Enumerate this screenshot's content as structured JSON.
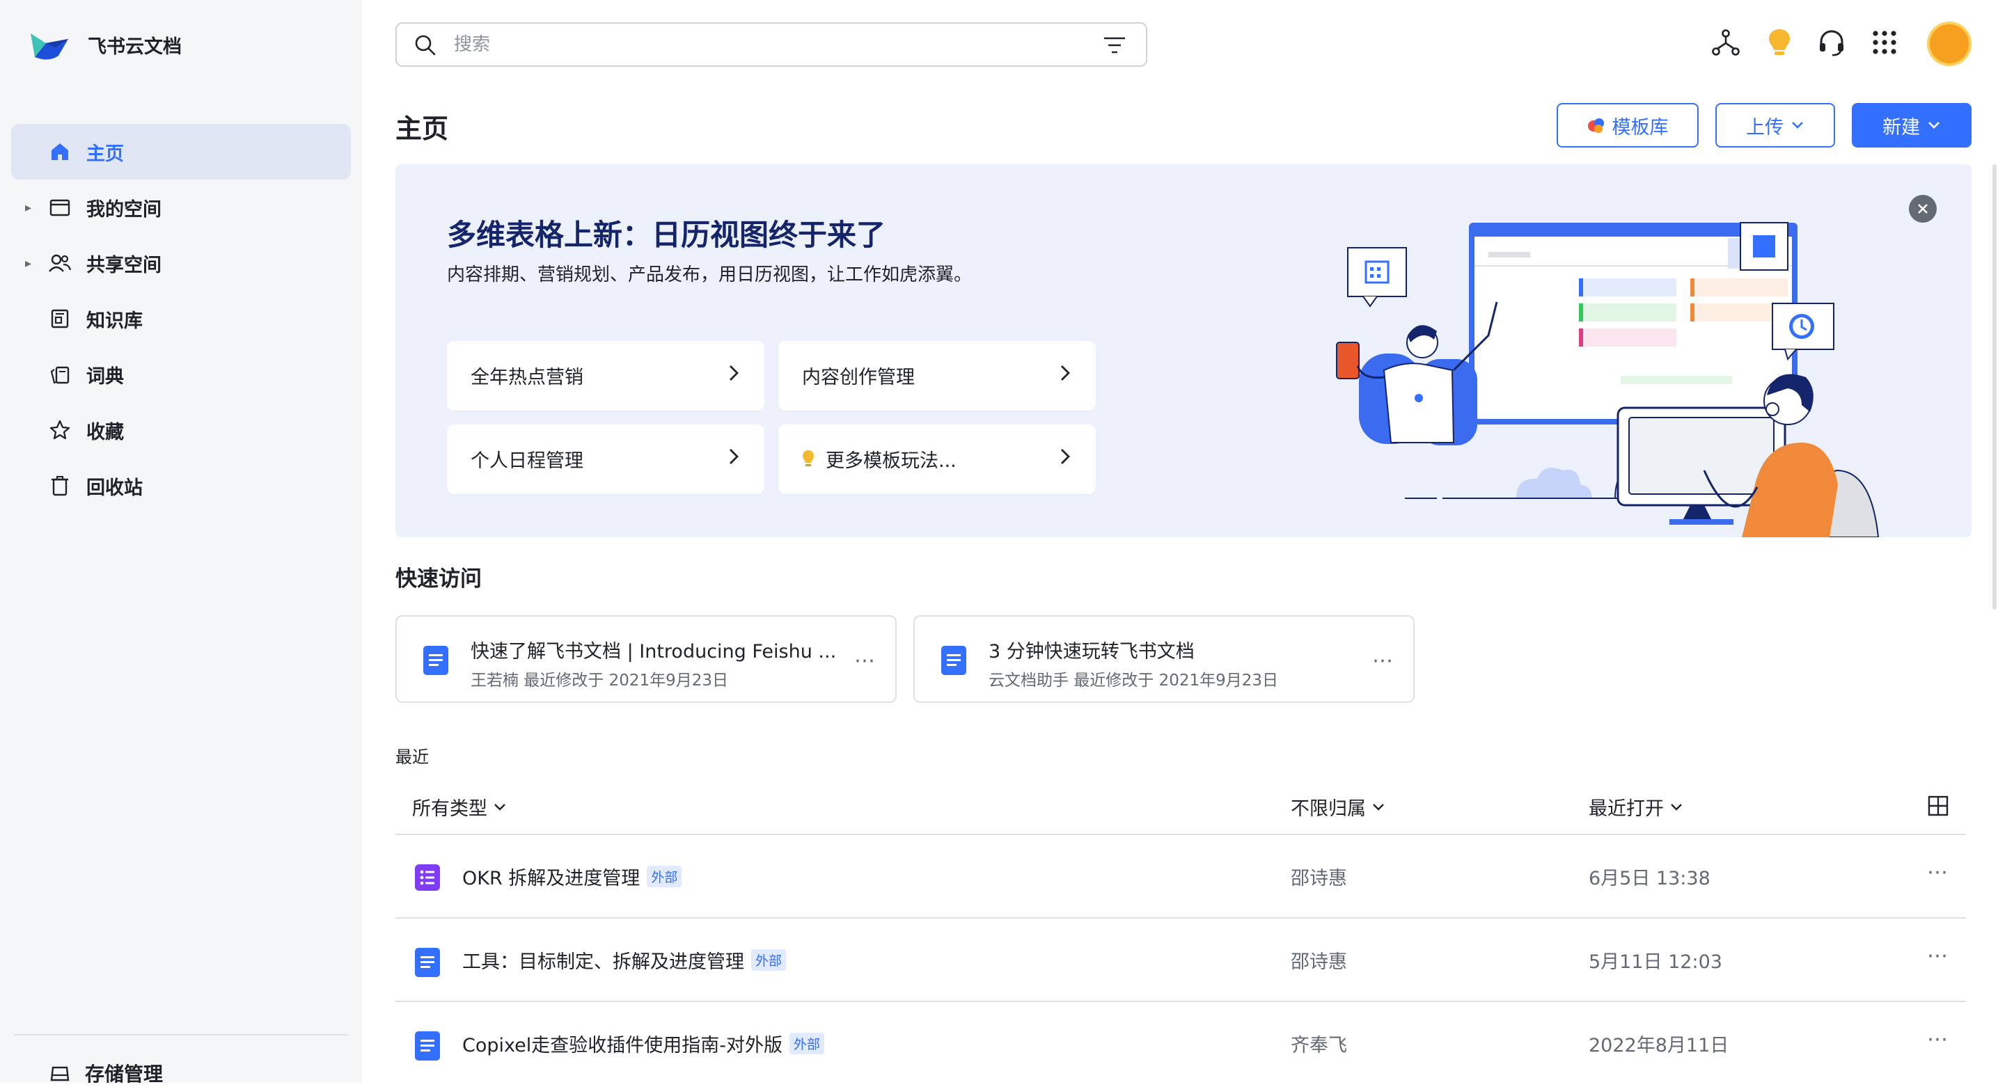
{
  "app": {
    "name": "飞书云文档"
  },
  "sidebar": {
    "items": [
      {
        "label": "主页",
        "icon": "home-icon"
      },
      {
        "label": "我的空间",
        "icon": "folder-icon"
      },
      {
        "label": "共享空间",
        "icon": "users-icon"
      },
      {
        "label": "知识库",
        "icon": "book-icon"
      },
      {
        "label": "词典",
        "icon": "dictionary-icon"
      },
      {
        "label": "收藏",
        "icon": "star-icon"
      },
      {
        "label": "回收站",
        "icon": "trash-icon"
      }
    ],
    "storage_label": "存储管理"
  },
  "search": {
    "placeholder": "搜索"
  },
  "header": {
    "title": "主页",
    "template_label": "模板库",
    "upload_label": "上传",
    "new_label": "新建"
  },
  "banner": {
    "title": "多维表格上新：日历视图终于来了",
    "subtitle": "内容排期、营销规划、产品发布，用日历视图，让工作如虎添翼。",
    "cards": [
      {
        "label": "全年热点营销"
      },
      {
        "label": "内容创作管理"
      },
      {
        "label": "个人日程管理"
      },
      {
        "label": "更多模板玩法..."
      }
    ]
  },
  "quick_access": {
    "title": "快速访问",
    "items": [
      {
        "name": "快速了解飞书文档 | Introducing Feishu ...",
        "meta": "王若楠 最近修改于 2021年9月23日"
      },
      {
        "name": "3 分钟快速玩转飞书文档",
        "meta": "云文档助手 最近修改于 2021年9月23日"
      }
    ]
  },
  "recent": {
    "title": "最近",
    "filters": {
      "type": "所有类型",
      "owner": "不限归属",
      "sort": "最近打开"
    },
    "rows": [
      {
        "name": "OKR 拆解及进度管理",
        "badge": "外部",
        "owner": "邵诗惠",
        "time": "6月5日 13:38",
        "icon": "bitable-icon"
      },
      {
        "name": "工具：目标制定、拆解及进度管理",
        "badge": "外部",
        "owner": "邵诗惠",
        "time": "5月11日 12:03",
        "icon": "doc-icon"
      },
      {
        "name": "Copixel走查验收插件使用指南-对外版",
        "badge": "外部",
        "owner": "齐奉飞",
        "time": "2022年8月11日",
        "icon": "doc-icon"
      }
    ]
  },
  "colors": {
    "accent": "#3370ff",
    "sidebar_bg": "#f5f6f7",
    "banner_bg": "#edf1fc"
  }
}
